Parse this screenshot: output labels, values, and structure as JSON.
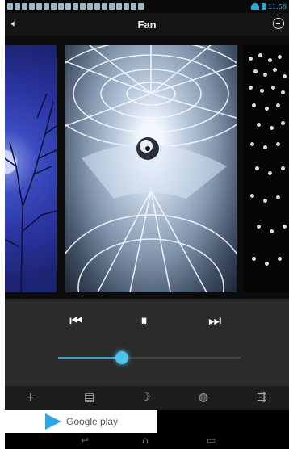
{
  "status_bar": {
    "time": "11:58",
    "icons": [
      "download-icon",
      "warning-icon",
      "image-icon",
      "calendar-icon",
      "download-icon",
      "image-icon",
      "dollar-icon",
      "mail-icon",
      "square-icon",
      "note-icon",
      "sound-icon",
      "download-icon",
      "square-icon",
      "square-icon",
      "square-icon",
      "square-icon",
      "square-icon",
      "square-icon",
      "square-icon"
    ]
  },
  "action_bar": {
    "title": "Fan",
    "left_icon": "volume-icon",
    "right_icon": "timer-icon"
  },
  "carousel": {
    "cards": [
      "moon-night-scene",
      "fan",
      "lights"
    ],
    "selected": "fan"
  },
  "controls": {
    "prev_glyph": "⏮",
    "pause_glyph": "⏸",
    "next_glyph": "⏭",
    "volume_level": 0.35
  },
  "toolbar": {
    "add_glyph": "+",
    "list_glyph": "▤",
    "moon_glyph": "☽",
    "globe_glyph": "◍",
    "settings_glyph": "⇶"
  },
  "ad": {
    "text": "Google play"
  },
  "nav_bar": {
    "back_glyph": "↩",
    "home_glyph": "⌂",
    "recent_glyph": "▭"
  },
  "colors": {
    "accent": "#36a8d6",
    "background": "#000000",
    "control_panel": "#2b2b2b"
  }
}
